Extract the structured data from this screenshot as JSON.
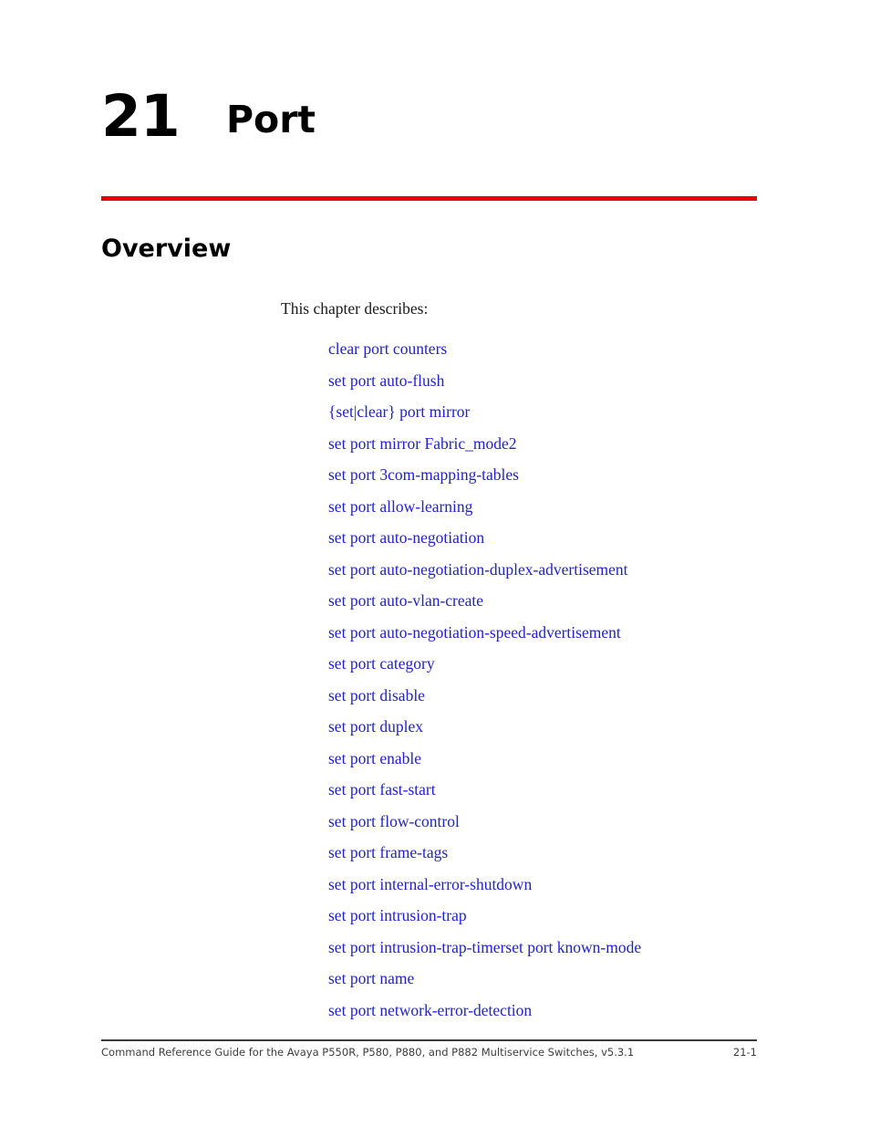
{
  "chapter": {
    "number": "21",
    "title": "Port"
  },
  "colors": {
    "rule_red": "#ED0000",
    "link_blue": "#2222CC",
    "text_black": "#000000",
    "footer_gray": "#3d3d3d"
  },
  "section": {
    "heading": "Overview",
    "intro": "This chapter describes:"
  },
  "links": [
    {
      "label": "clear port counters"
    },
    {
      "label": "set port auto-flush"
    },
    {
      "label": "{set|clear} port mirror"
    },
    {
      "label": "set port mirror Fabric_mode2"
    },
    {
      "label": "set port 3com-mapping-tables"
    },
    {
      "label": "set port allow-learning"
    },
    {
      "label": "set port auto-negotiation"
    },
    {
      "label": "set port auto-negotiation-duplex-advertisement"
    },
    {
      "label": "set port auto-vlan-create"
    },
    {
      "label": "set port auto-negotiation-speed-advertisement"
    },
    {
      "label": "set port category"
    },
    {
      "label": "set port disable"
    },
    {
      "label": "set port duplex"
    },
    {
      "label": "set port enable"
    },
    {
      "label": "set port fast-start"
    },
    {
      "label": "set port flow-control"
    },
    {
      "label": "set port frame-tags"
    },
    {
      "label": "set port internal-error-shutdown"
    },
    {
      "label": "set port intrusion-trap"
    },
    {
      "label": "set port intrusion-trap-timerset port known-mode"
    },
    {
      "label": "set port name"
    },
    {
      "label": "set port network-error-detection"
    }
  ],
  "footer": {
    "text": "Command Reference Guide for the Avaya P550R, P580, P880, and P882 Multiservice Switches, v5.3.1",
    "page": "21-1"
  }
}
